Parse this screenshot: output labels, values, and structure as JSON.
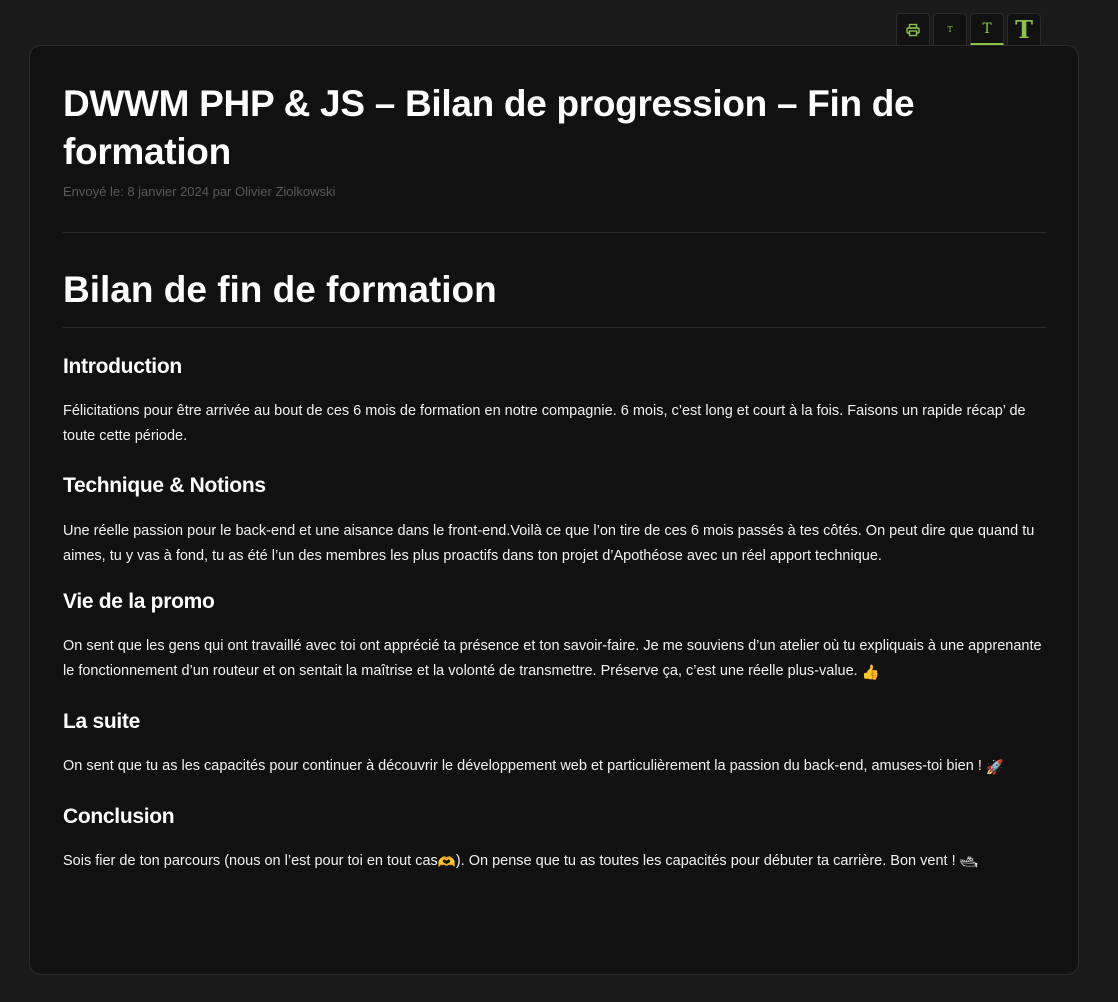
{
  "toolbar": {
    "print_icon": "printer-icon",
    "small_text_label": "T",
    "medium_text_label": "T",
    "large_text_label": "T"
  },
  "article": {
    "title": "DWWM PHP & JS – Bilan de progression – Fin de formation",
    "meta": "Envoyé le: 8 janvier 2024 par Olivier Ziolkowski",
    "heading": "Bilan de fin de formation",
    "sections": [
      {
        "title": "Introduction",
        "text": "Félicitations pour être arrivée au bout de ces 6 mois de formation en notre compagnie. 6 mois, c’est long et court à la fois. Faisons un rapide récap’ de toute cette période."
      },
      {
        "title": "Technique & Notions",
        "text": "Une réelle passion pour le back-end et une aisance dans le front-end.Voilà ce que l’on tire de ces 6 mois passés à tes côtés. On peut dire que quand tu aimes, tu y vas à fond, tu as été l’un des membres les plus proactifs dans ton projet d’Apothéose avec un réel apport technique."
      },
      {
        "title": "Vie de la promo",
        "text": "On sent que les gens qui ont travaillé avec toi ont apprécié ta présence et ton savoir-faire. Je me souviens d’un atelier où tu expliquais à une apprenante le fonctionnement d’un routeur et on sentait la maîtrise et la volonté de transmettre. Préserve ça, c’est une réelle plus-value.",
        "emoji": "👍"
      },
      {
        "title": "La suite",
        "text": "On sent que tu as les capacités pour continuer à découvrir le développement web et particulièrement la passion du back-end, amuses-toi bien !",
        "emoji": "🚀"
      },
      {
        "title": "Conclusion",
        "text_before": "Sois fier de ton parcours (nous on l’est pour toi en tout cas",
        "emoji_inline": "🫶",
        "text_after": "). On pense que tu as toutes les capacités pour débuter ta carrière. Bon vent !",
        "emoji": "🛥"
      }
    ]
  },
  "colors": {
    "accent": "#8bc34a",
    "background": "#1a1a1a",
    "card": "#111111"
  }
}
